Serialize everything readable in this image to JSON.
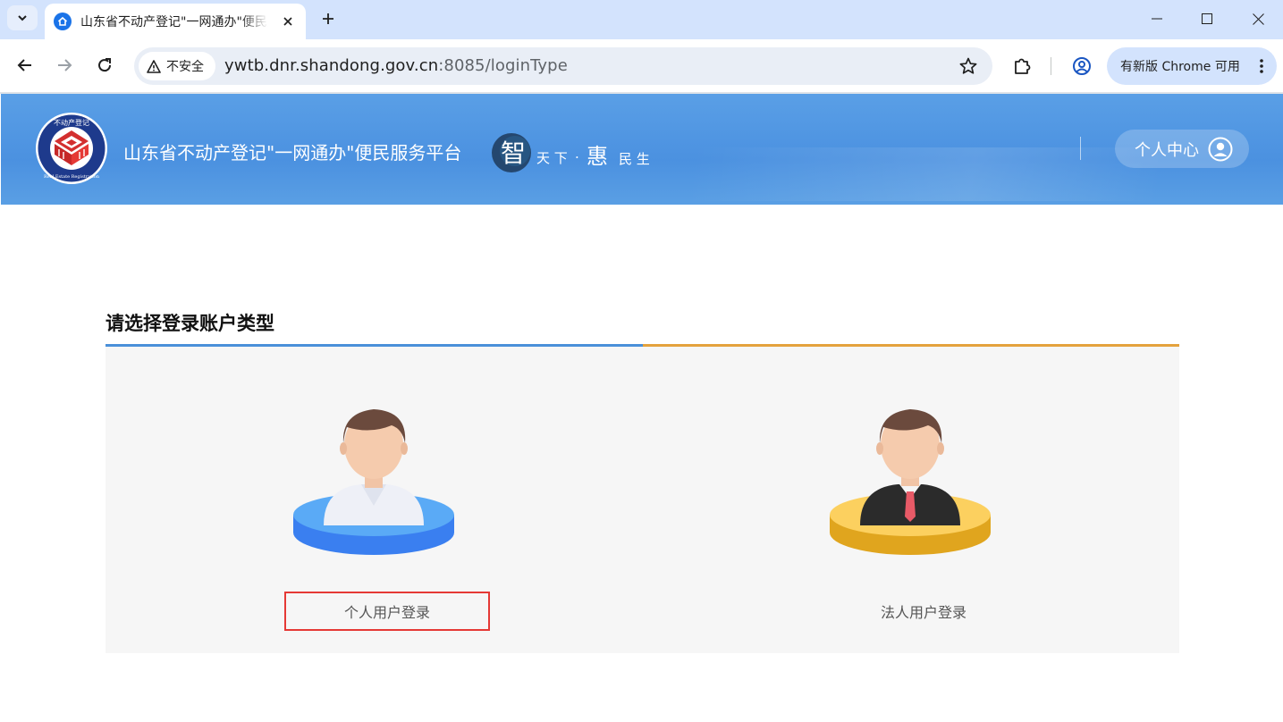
{
  "browser": {
    "tab_title": "山东省不动产登记\"一网通办\"便民服务平台",
    "security_label": "不安全",
    "url_host": "ywtb.dnr.shandong.gov.cn",
    "url_path": ":8085/loginType",
    "update_label": "有新版 Chrome 可用",
    "icons": [
      "tab-search-icon",
      "home-favicon-icon",
      "close-icon",
      "plus-icon",
      "minimize-icon",
      "maximize-icon",
      "close-window-icon",
      "back-icon",
      "forward-icon",
      "reload-icon",
      "warning-icon",
      "star-icon",
      "extensions-icon",
      "profile-icon",
      "more-vert-icon"
    ]
  },
  "header": {
    "site_title": "山东省不动产登记\"一网通办\"便民服务平台",
    "slogan": {
      "zhi": "智",
      "tianxia": "天 下",
      "dot": "·",
      "hui": "惠",
      "minsheng": "民 生"
    },
    "personal_center": "个人中心",
    "logo_ring_text": "不动产登记",
    "logo_bottom_text": "Real Estate Registration",
    "colors": {
      "header_bg": "#4b91e0"
    }
  },
  "main": {
    "section_title": "请选择登录账户类型",
    "colors": {
      "left_accent": "#4a90d9",
      "right_accent": "#e4a23d",
      "panel_bg": "#f6f6f6"
    },
    "cards": [
      {
        "label": "个人用户登录",
        "selected": true
      },
      {
        "label": "法人用户登录",
        "selected": false
      }
    ]
  }
}
